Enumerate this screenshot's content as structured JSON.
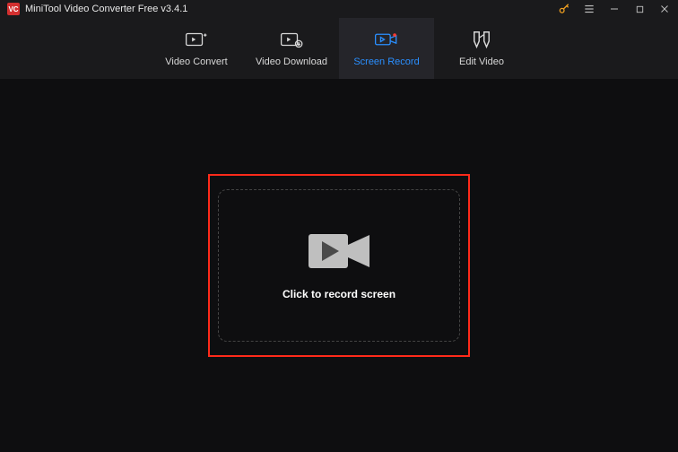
{
  "app": {
    "title": "MiniTool Video Converter Free v3.4.1",
    "logo_text": "VC"
  },
  "tabs": {
    "convert": "Video Convert",
    "download": "Video Download",
    "record": "Screen Record",
    "edit": "Edit Video"
  },
  "main": {
    "record_prompt": "Click to record screen"
  }
}
